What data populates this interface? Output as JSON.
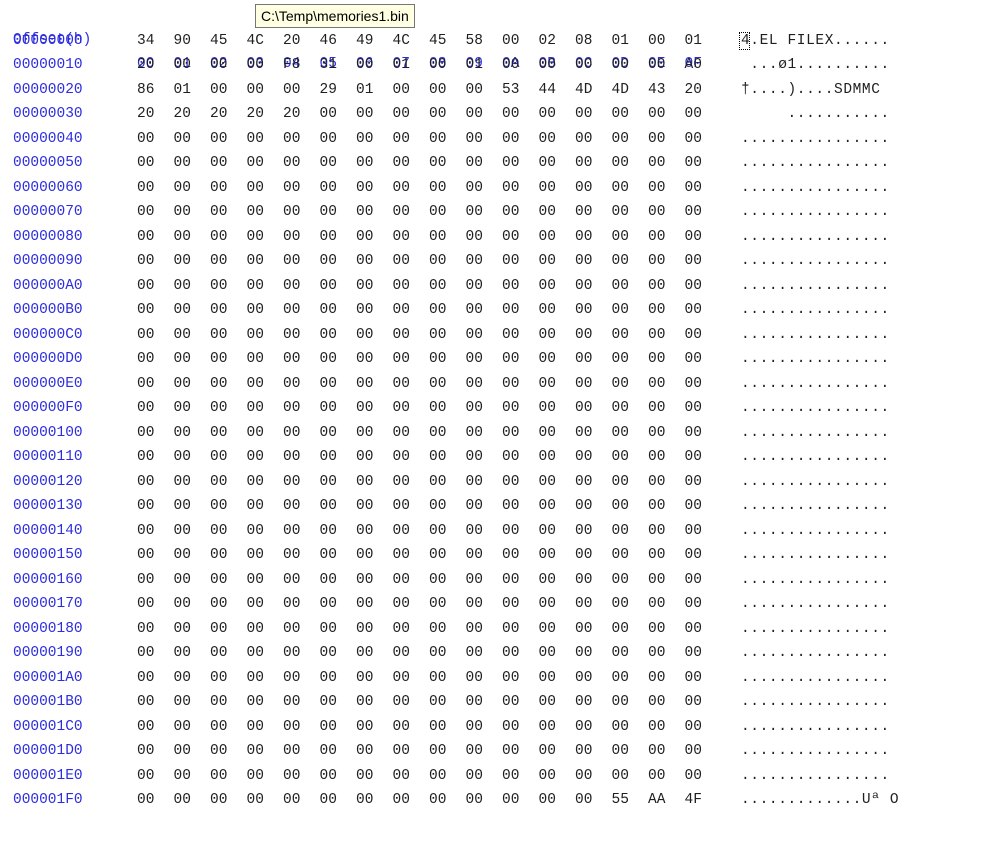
{
  "header": {
    "offset_label": "Offset(h)",
    "columns": [
      "00",
      "01",
      "02",
      "03",
      "04",
      "05",
      "06",
      "07",
      "08",
      "09",
      "0A",
      "0B",
      "0C",
      "0D",
      "0E",
      "0F"
    ]
  },
  "tooltip": {
    "text": "C:\\Temp\\memories1.bin"
  },
  "rows": [
    {
      "offset": "00000000",
      "bytes": [
        "34",
        "90",
        "45",
        "4C",
        "20",
        "46",
        "49",
        "4C",
        "45",
        "58",
        "00",
        "02",
        "08",
        "01",
        "00",
        "01"
      ],
      "ascii": "4.EL FILEX......"
    },
    {
      "offset": "00000010",
      "bytes": [
        "20",
        "00",
        "00",
        "00",
        "F8",
        "31",
        "00",
        "01",
        "00",
        "01",
        "00",
        "00",
        "00",
        "00",
        "00",
        "A0"
      ],
      "ascii": " ...ø1.........."
    },
    {
      "offset": "00000020",
      "bytes": [
        "86",
        "01",
        "00",
        "00",
        "00",
        "29",
        "01",
        "00",
        "00",
        "00",
        "53",
        "44",
        "4D",
        "4D",
        "43",
        "20"
      ],
      "ascii": "†....)....SDMMC "
    },
    {
      "offset": "00000030",
      "bytes": [
        "20",
        "20",
        "20",
        "20",
        "20",
        "00",
        "00",
        "00",
        "00",
        "00",
        "00",
        "00",
        "00",
        "00",
        "00",
        "00"
      ],
      "ascii": "     ..........."
    },
    {
      "offset": "00000040",
      "bytes": [
        "00",
        "00",
        "00",
        "00",
        "00",
        "00",
        "00",
        "00",
        "00",
        "00",
        "00",
        "00",
        "00",
        "00",
        "00",
        "00"
      ],
      "ascii": "................"
    },
    {
      "offset": "00000050",
      "bytes": [
        "00",
        "00",
        "00",
        "00",
        "00",
        "00",
        "00",
        "00",
        "00",
        "00",
        "00",
        "00",
        "00",
        "00",
        "00",
        "00"
      ],
      "ascii": "................"
    },
    {
      "offset": "00000060",
      "bytes": [
        "00",
        "00",
        "00",
        "00",
        "00",
        "00",
        "00",
        "00",
        "00",
        "00",
        "00",
        "00",
        "00",
        "00",
        "00",
        "00"
      ],
      "ascii": "................"
    },
    {
      "offset": "00000070",
      "bytes": [
        "00",
        "00",
        "00",
        "00",
        "00",
        "00",
        "00",
        "00",
        "00",
        "00",
        "00",
        "00",
        "00",
        "00",
        "00",
        "00"
      ],
      "ascii": "................"
    },
    {
      "offset": "00000080",
      "bytes": [
        "00",
        "00",
        "00",
        "00",
        "00",
        "00",
        "00",
        "00",
        "00",
        "00",
        "00",
        "00",
        "00",
        "00",
        "00",
        "00"
      ],
      "ascii": "................"
    },
    {
      "offset": "00000090",
      "bytes": [
        "00",
        "00",
        "00",
        "00",
        "00",
        "00",
        "00",
        "00",
        "00",
        "00",
        "00",
        "00",
        "00",
        "00",
        "00",
        "00"
      ],
      "ascii": "................"
    },
    {
      "offset": "000000A0",
      "bytes": [
        "00",
        "00",
        "00",
        "00",
        "00",
        "00",
        "00",
        "00",
        "00",
        "00",
        "00",
        "00",
        "00",
        "00",
        "00",
        "00"
      ],
      "ascii": "................"
    },
    {
      "offset": "000000B0",
      "bytes": [
        "00",
        "00",
        "00",
        "00",
        "00",
        "00",
        "00",
        "00",
        "00",
        "00",
        "00",
        "00",
        "00",
        "00",
        "00",
        "00"
      ],
      "ascii": "................"
    },
    {
      "offset": "000000C0",
      "bytes": [
        "00",
        "00",
        "00",
        "00",
        "00",
        "00",
        "00",
        "00",
        "00",
        "00",
        "00",
        "00",
        "00",
        "00",
        "00",
        "00"
      ],
      "ascii": "................"
    },
    {
      "offset": "000000D0",
      "bytes": [
        "00",
        "00",
        "00",
        "00",
        "00",
        "00",
        "00",
        "00",
        "00",
        "00",
        "00",
        "00",
        "00",
        "00",
        "00",
        "00"
      ],
      "ascii": "................"
    },
    {
      "offset": "000000E0",
      "bytes": [
        "00",
        "00",
        "00",
        "00",
        "00",
        "00",
        "00",
        "00",
        "00",
        "00",
        "00",
        "00",
        "00",
        "00",
        "00",
        "00"
      ],
      "ascii": "................"
    },
    {
      "offset": "000000F0",
      "bytes": [
        "00",
        "00",
        "00",
        "00",
        "00",
        "00",
        "00",
        "00",
        "00",
        "00",
        "00",
        "00",
        "00",
        "00",
        "00",
        "00"
      ],
      "ascii": "................"
    },
    {
      "offset": "00000100",
      "bytes": [
        "00",
        "00",
        "00",
        "00",
        "00",
        "00",
        "00",
        "00",
        "00",
        "00",
        "00",
        "00",
        "00",
        "00",
        "00",
        "00"
      ],
      "ascii": "................"
    },
    {
      "offset": "00000110",
      "bytes": [
        "00",
        "00",
        "00",
        "00",
        "00",
        "00",
        "00",
        "00",
        "00",
        "00",
        "00",
        "00",
        "00",
        "00",
        "00",
        "00"
      ],
      "ascii": "................"
    },
    {
      "offset": "00000120",
      "bytes": [
        "00",
        "00",
        "00",
        "00",
        "00",
        "00",
        "00",
        "00",
        "00",
        "00",
        "00",
        "00",
        "00",
        "00",
        "00",
        "00"
      ],
      "ascii": "................"
    },
    {
      "offset": "00000130",
      "bytes": [
        "00",
        "00",
        "00",
        "00",
        "00",
        "00",
        "00",
        "00",
        "00",
        "00",
        "00",
        "00",
        "00",
        "00",
        "00",
        "00"
      ],
      "ascii": "................"
    },
    {
      "offset": "00000140",
      "bytes": [
        "00",
        "00",
        "00",
        "00",
        "00",
        "00",
        "00",
        "00",
        "00",
        "00",
        "00",
        "00",
        "00",
        "00",
        "00",
        "00"
      ],
      "ascii": "................"
    },
    {
      "offset": "00000150",
      "bytes": [
        "00",
        "00",
        "00",
        "00",
        "00",
        "00",
        "00",
        "00",
        "00",
        "00",
        "00",
        "00",
        "00",
        "00",
        "00",
        "00"
      ],
      "ascii": "................"
    },
    {
      "offset": "00000160",
      "bytes": [
        "00",
        "00",
        "00",
        "00",
        "00",
        "00",
        "00",
        "00",
        "00",
        "00",
        "00",
        "00",
        "00",
        "00",
        "00",
        "00"
      ],
      "ascii": "................"
    },
    {
      "offset": "00000170",
      "bytes": [
        "00",
        "00",
        "00",
        "00",
        "00",
        "00",
        "00",
        "00",
        "00",
        "00",
        "00",
        "00",
        "00",
        "00",
        "00",
        "00"
      ],
      "ascii": "................"
    },
    {
      "offset": "00000180",
      "bytes": [
        "00",
        "00",
        "00",
        "00",
        "00",
        "00",
        "00",
        "00",
        "00",
        "00",
        "00",
        "00",
        "00",
        "00",
        "00",
        "00"
      ],
      "ascii": "................"
    },
    {
      "offset": "00000190",
      "bytes": [
        "00",
        "00",
        "00",
        "00",
        "00",
        "00",
        "00",
        "00",
        "00",
        "00",
        "00",
        "00",
        "00",
        "00",
        "00",
        "00"
      ],
      "ascii": "................"
    },
    {
      "offset": "000001A0",
      "bytes": [
        "00",
        "00",
        "00",
        "00",
        "00",
        "00",
        "00",
        "00",
        "00",
        "00",
        "00",
        "00",
        "00",
        "00",
        "00",
        "00"
      ],
      "ascii": "................"
    },
    {
      "offset": "000001B0",
      "bytes": [
        "00",
        "00",
        "00",
        "00",
        "00",
        "00",
        "00",
        "00",
        "00",
        "00",
        "00",
        "00",
        "00",
        "00",
        "00",
        "00"
      ],
      "ascii": "................"
    },
    {
      "offset": "000001C0",
      "bytes": [
        "00",
        "00",
        "00",
        "00",
        "00",
        "00",
        "00",
        "00",
        "00",
        "00",
        "00",
        "00",
        "00",
        "00",
        "00",
        "00"
      ],
      "ascii": "................"
    },
    {
      "offset": "000001D0",
      "bytes": [
        "00",
        "00",
        "00",
        "00",
        "00",
        "00",
        "00",
        "00",
        "00",
        "00",
        "00",
        "00",
        "00",
        "00",
        "00",
        "00"
      ],
      "ascii": "................"
    },
    {
      "offset": "000001E0",
      "bytes": [
        "00",
        "00",
        "00",
        "00",
        "00",
        "00",
        "00",
        "00",
        "00",
        "00",
        "00",
        "00",
        "00",
        "00",
        "00",
        "00"
      ],
      "ascii": "................"
    },
    {
      "offset": "000001F0",
      "bytes": [
        "00",
        "00",
        "00",
        "00",
        "00",
        "00",
        "00",
        "00",
        "00",
        "00",
        "00",
        "00",
        "00",
        "55",
        "AA",
        "4F"
      ],
      "ascii": ".............Uª O"
    }
  ],
  "colors": {
    "offset_color": "#2d2de0",
    "byte_color": "#1f1f1f",
    "tooltip_bg": "#ffffe1"
  }
}
